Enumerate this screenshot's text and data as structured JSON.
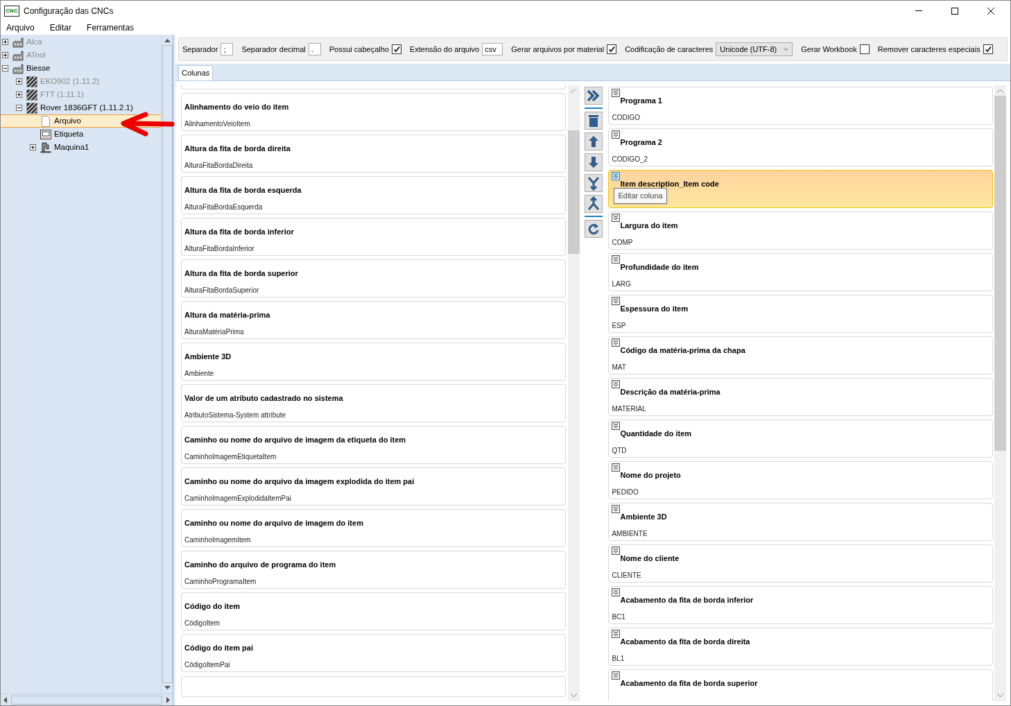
{
  "window": {
    "title": "Configuração das CNCs",
    "logo_text": "CNC"
  },
  "menu": [
    "Arquivo",
    "Editar",
    "Ferramentas"
  ],
  "tree": [
    {
      "label": "Alca",
      "kind": "factory",
      "enabled": false,
      "expanded": false,
      "selected": false
    },
    {
      "label": "ATool",
      "kind": "factory",
      "enabled": false,
      "expanded": false,
      "selected": false
    },
    {
      "label": "Biesse",
      "kind": "factory",
      "enabled": true,
      "expanded": true,
      "selected": false,
      "children": [
        {
          "label": "EKO902 (1.11.2)",
          "kind": "machine",
          "enabled": false,
          "expanded": false,
          "selected": false
        },
        {
          "label": "FTT (1.11.1)",
          "kind": "machine",
          "enabled": false,
          "expanded": false,
          "selected": false
        },
        {
          "label": "Rover 1836GFT (1.11.2.1)",
          "kind": "machine",
          "enabled": true,
          "expanded": true,
          "selected": false,
          "children": [
            {
              "label": "Arquivo",
              "kind": "file",
              "enabled": true,
              "selected": true
            },
            {
              "label": "Etiqueta",
              "kind": "label",
              "enabled": true,
              "selected": false
            },
            {
              "label": "Maquina1",
              "kind": "device",
              "enabled": true,
              "expanded": false,
              "selected": false
            }
          ]
        }
      ]
    }
  ],
  "options": [
    {
      "kind": "text",
      "label": "Separador",
      "value": ";"
    },
    {
      "kind": "text",
      "label": "Separador decimal",
      "value": "."
    },
    {
      "kind": "checkbox",
      "label": "Possui cabeçalho",
      "checked": true
    },
    {
      "kind": "text",
      "label": "Extensão do arquivo",
      "value": "csv"
    },
    {
      "kind": "checkbox",
      "label": "Gerar arquivos por material",
      "checked": true
    },
    {
      "kind": "select",
      "label": "Codificação de caracteres",
      "value": "Unicode (UTF-8)"
    },
    {
      "kind": "checkbox",
      "label": "Gerar Workbook",
      "checked": false
    },
    {
      "kind": "checkbox",
      "label": "Remover caracteres especiais",
      "checked": true
    }
  ],
  "tabs": [
    {
      "label": "Colunas",
      "selected": true
    }
  ],
  "available_columns": [
    {
      "title": "Alinhamento do veio do item",
      "field": "AlinhamentoVeioItem"
    },
    {
      "title": "Altura da fita de borda direita",
      "field": "AlturaFitaBordaDireita"
    },
    {
      "title": "Altura da fita de borda esquerda",
      "field": "AlturaFitaBordaEsquerda"
    },
    {
      "title": "Altura da fita de borda inferior",
      "field": "AlturaFitaBordaInferior"
    },
    {
      "title": "Altura da fita de borda superior",
      "field": "AlturaFitaBordaSuperior"
    },
    {
      "title": "Altura da matéria-prima",
      "field": "AlturaMatériaPrima"
    },
    {
      "title": "Ambiente 3D",
      "field": "Ambiente"
    },
    {
      "title": "Valor de um atributo cadastrado no sistema",
      "field": "AtributoSistema-System attribute"
    },
    {
      "title": "Caminho ou nome do arquivo de imagem da etiqueta do item",
      "field": "CaminhoImagemEtiquetaItem"
    },
    {
      "title": "Caminho ou nome do arquivo da imagem explodida do item pai",
      "field": "CaminhoImagemExplodidaItemPai"
    },
    {
      "title": "Caminho ou nome do arquivo de imagem do item",
      "field": "CaminhoImagemItem"
    },
    {
      "title": "Caminho do arquivo de programa do item",
      "field": "CaminhoProgramaItem"
    },
    {
      "title": "Código do item",
      "field": "CódigoItem"
    },
    {
      "title": "Código do item pai",
      "field": "CódigoItemPai"
    }
  ],
  "selected_columns": [
    {
      "title": "Programa 1",
      "field": "CODIGO",
      "selected": false
    },
    {
      "title": "Programa 2",
      "field": "CODIGO_2",
      "selected": false
    },
    {
      "title": "Item description_Item code",
      "selected": true
    },
    {
      "title": "Largura do item",
      "field": "COMP",
      "selected": false
    },
    {
      "title": "Profundidade do item",
      "field": "LARG",
      "selected": false
    },
    {
      "title": "Espessura do item",
      "field": "ESP",
      "selected": false
    },
    {
      "title": "Código da matéria-prima da chapa",
      "field": "MAT",
      "selected": false
    },
    {
      "title": "Descrição da matéria-prima",
      "field": "MATERIAL",
      "selected": false
    },
    {
      "title": "Quantidade do item",
      "field": "QTD",
      "selected": false
    },
    {
      "title": "Nome do projeto",
      "field": "PEDIDO",
      "selected": false
    },
    {
      "title": "Ambiente 3D",
      "field": "AMBIENTE",
      "selected": false
    },
    {
      "title": "Nome do cliente",
      "field": "CLIENTE",
      "selected": false
    },
    {
      "title": "Acabamento da fita de borda inferior",
      "field": "BC1",
      "selected": false
    },
    {
      "title": "Acabamento da fita de borda direita",
      "field": "BL1",
      "selected": false
    },
    {
      "title": "Acabamento da fita de borda superior",
      "selected": false
    }
  ],
  "tooltip": "Editar coluna"
}
